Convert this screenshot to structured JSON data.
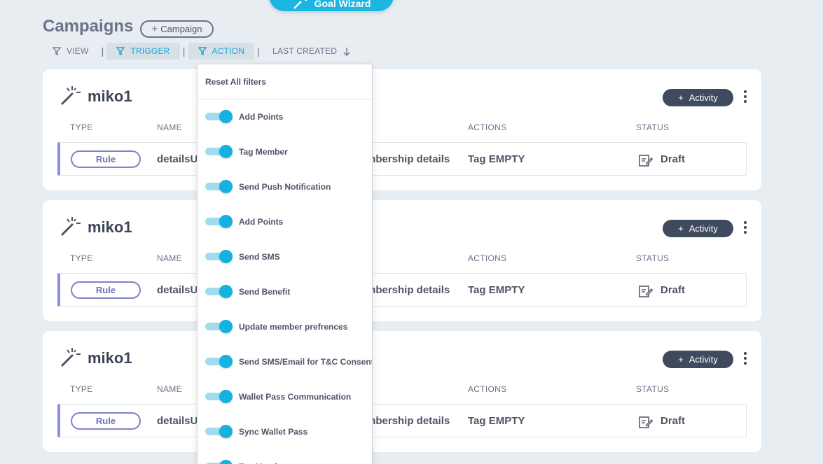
{
  "goal_wizard_label": "Goal Wizard",
  "page_title": "Campaigns",
  "add_campaign_label": "Campaign",
  "filters": {
    "view": "VIEW",
    "trigger": "TRIGGER",
    "action": "ACTION",
    "sort": "LAST CREATED",
    "separator": "|"
  },
  "table_headers": {
    "type": "TYPE",
    "name": "NAME",
    "actions": "ACTIONS",
    "status": "STATUS"
  },
  "activity_label": "Activity",
  "campaigns": [
    {
      "title": "miko1",
      "type": "Rule",
      "name": "detailsU",
      "trigger_partial": "mbership details",
      "action": "Tag EMPTY",
      "status": "Draft"
    },
    {
      "title": "miko1",
      "type": "Rule",
      "name": "detailsU",
      "trigger_partial": "mbership details",
      "action": "Tag EMPTY",
      "status": "Draft"
    },
    {
      "title": "miko1",
      "type": "Rule",
      "name": "detailsU",
      "trigger_partial": "mbership details",
      "action": "Tag EMPTY",
      "status": "Draft"
    }
  ],
  "dropdown": {
    "reset_label": "Reset All filters",
    "items": [
      {
        "label": "Add Points",
        "enabled": true
      },
      {
        "label": "Tag Member",
        "enabled": true
      },
      {
        "label": "Send Push Notification",
        "enabled": true
      },
      {
        "label": "Add Points",
        "enabled": true
      },
      {
        "label": "Send SMS",
        "enabled": true
      },
      {
        "label": "Send Benefit",
        "enabled": true
      },
      {
        "label": "Update member prefrences",
        "enabled": true
      },
      {
        "label": "Send SMS/Email for T&C Consent",
        "enabled": true
      },
      {
        "label": "Wallet Pass Communication",
        "enabled": true
      },
      {
        "label": "Sync Wallet Pass",
        "enabled": true
      },
      {
        "label": "Tag Member",
        "enabled": true
      }
    ]
  },
  "colors": {
    "accent": "#1bb5e1",
    "dark_button": "#3f4a5e",
    "rule_border": "#7e83c9",
    "background": "#e8edf1"
  }
}
